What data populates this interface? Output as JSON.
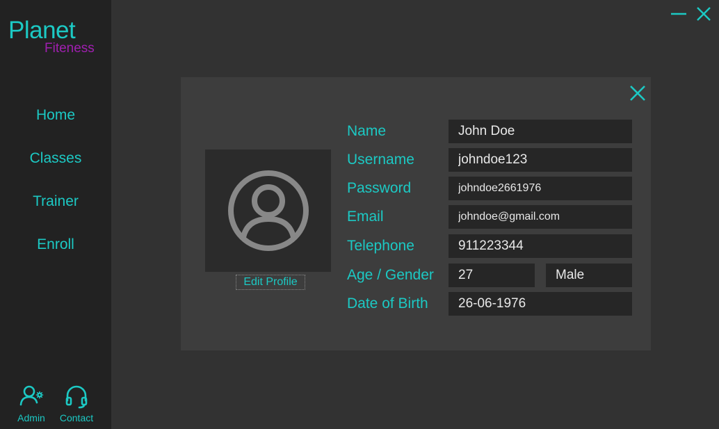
{
  "brand": {
    "name": "Planet",
    "sub": "Fiteness"
  },
  "colors": {
    "accent": "#1cc9c4",
    "brand_sub": "#a01fb0",
    "sidebar_bg": "#222222",
    "main_bg": "#323232",
    "panel_bg": "#3d3d3d",
    "input_bg": "#262626"
  },
  "nav": {
    "home": "Home",
    "classes": "Classes",
    "trainer": "Trainer",
    "enroll": "Enroll"
  },
  "bottom": {
    "admin": {
      "label": "Admin",
      "icon": "user-gear-icon"
    },
    "contact": {
      "label": "Contact",
      "icon": "headset-icon"
    }
  },
  "window": {
    "minimize_icon": "minimize-icon",
    "close_icon": "close-icon"
  },
  "profile": {
    "edit_label": "Edit Profile",
    "avatar_icon": "user-circle-icon",
    "fields": {
      "name": {
        "label": "Name",
        "value": "John Doe"
      },
      "username": {
        "label": "Username",
        "value": "johndoe123"
      },
      "password": {
        "label": "Password",
        "value": "johndoe2661976"
      },
      "email": {
        "label": "Email",
        "value": "johndoe@gmail.com"
      },
      "telephone": {
        "label": "Telephone",
        "value": "911223344"
      },
      "age_gender": {
        "label": "Age / Gender",
        "age": "27",
        "gender": "Male"
      },
      "dob": {
        "label": "Date of Birth",
        "value": "26-06-1976"
      }
    }
  }
}
